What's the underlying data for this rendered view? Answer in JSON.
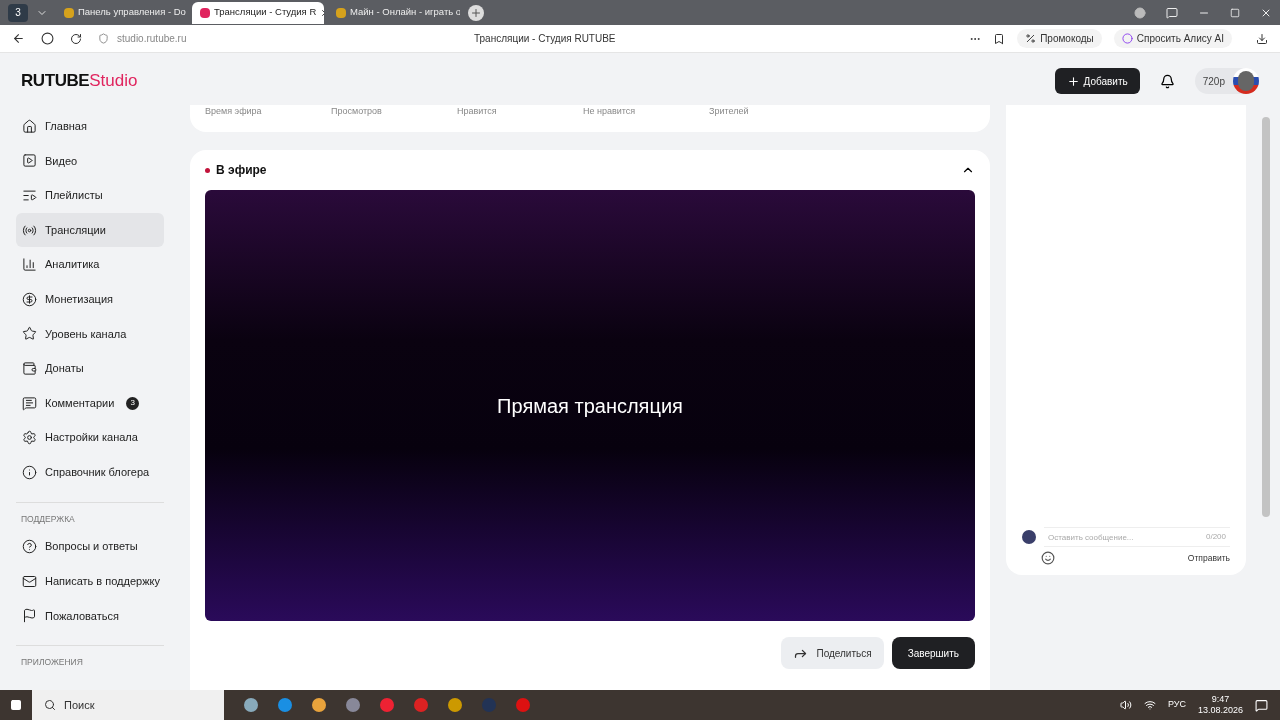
{
  "browser": {
    "tab_count": "3",
    "tabs": [
      {
        "title": "Панель управления - Do",
        "selected": false
      },
      {
        "title": "Трансляции - Студия R",
        "selected": true
      },
      {
        "title": "Майн - Онлайн - играть о",
        "selected": false
      }
    ],
    "address": "studio.rutube.ru",
    "page_title": "Трансляции - Студия RUTUBE",
    "actions": [
      "Промокоды",
      "Спросить Алису AI"
    ]
  },
  "header": {
    "logo": "RUTUBE",
    "logo_suffix": "Studio",
    "add_button": "Добавить",
    "quality": "720p"
  },
  "sidebar": {
    "items": [
      {
        "label": "Главная",
        "selected": false
      },
      {
        "label": "Видео",
        "selected": false
      },
      {
        "label": "Плейлисты",
        "selected": false
      },
      {
        "label": "Трансляции",
        "selected": true
      },
      {
        "label": "Аналитика",
        "selected": false
      },
      {
        "label": "Монетизация",
        "selected": false
      },
      {
        "label": "Уровень канала",
        "selected": false
      },
      {
        "label": "Донаты",
        "selected": false
      },
      {
        "label": "Комментарии",
        "selected": false,
        "badge": "3"
      },
      {
        "label": "Настройки канала",
        "selected": false
      },
      {
        "label": "Справочник блогера",
        "selected": false
      }
    ],
    "sections": [
      {
        "title": "ПОДДЕРЖКА",
        "items": [
          {
            "label": "Вопросы и ответы",
            "selected": false
          },
          {
            "label": "Написать в поддержку",
            "selected": false
          },
          {
            "label": "Пожаловаться",
            "selected": false
          }
        ]
      },
      {
        "title": "ПРИЛОЖЕНИЯ"
      }
    ]
  },
  "stats": [
    "Время эфира",
    "Просмотров",
    "Нравится",
    "Не нравится",
    "Зрителей"
  ],
  "stream": {
    "status": "В эфире",
    "expanded": true,
    "video_title": "Прямая трансляция",
    "share_button": "Поделиться",
    "end_button": "Завершить"
  },
  "chat": {
    "placeholder": "Оставить сообщение...",
    "counter": "0/200",
    "send_button": "Отправить"
  },
  "taskbar": {
    "search": "Поиск",
    "language": "РУС",
    "time": "9:47",
    "date": "13.08.2026"
  }
}
